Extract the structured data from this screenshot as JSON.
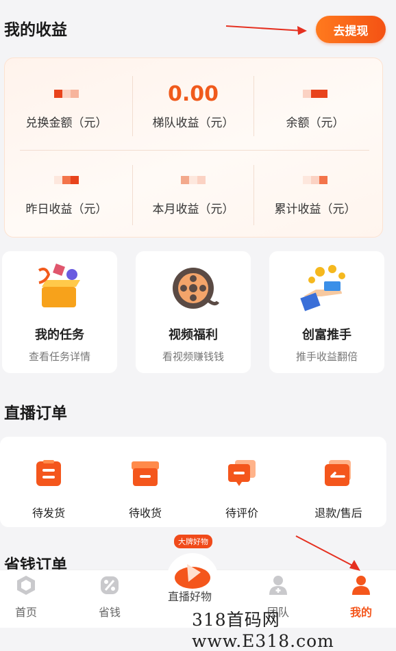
{
  "earnings": {
    "title": "我的收益",
    "withdraw_label": "去提现",
    "stats": [
      {
        "label": "兑换金额（元）",
        "value": ""
      },
      {
        "label": "梯队收益（元）",
        "value": "0.00"
      },
      {
        "label": "余额（元）",
        "value": ""
      },
      {
        "label": "昨日收益（元）",
        "value": ""
      },
      {
        "label": "本月收益（元）",
        "value": ""
      },
      {
        "label": "累计收益（元）",
        "value": ""
      }
    ]
  },
  "features": [
    {
      "title": "我的任务",
      "subtitle": "查看任务详情",
      "icon": "task-box-icon"
    },
    {
      "title": "视频福利",
      "subtitle": "看视频赚钱钱",
      "icon": "film-reel-icon"
    },
    {
      "title": "创富推手",
      "subtitle": "推手收益翻倍",
      "icon": "money-hand-icon"
    }
  ],
  "live_orders": {
    "title": "直播订单",
    "items": [
      {
        "label": "待发货",
        "icon": "pending-ship-icon"
      },
      {
        "label": "待收货",
        "icon": "pending-receive-icon"
      },
      {
        "label": "待评价",
        "icon": "pending-review-icon"
      },
      {
        "label": "退款/售后",
        "icon": "refund-icon"
      }
    ]
  },
  "save_orders": {
    "title": "省钱订单"
  },
  "tabbar": {
    "badge": "大牌好物",
    "items": [
      {
        "label": "首页",
        "icon": "home-icon"
      },
      {
        "label": "省钱",
        "icon": "save-icon"
      },
      {
        "label": "直播好物",
        "icon": "live-icon"
      },
      {
        "label": "团队",
        "icon": "team-icon"
      },
      {
        "label": "我的",
        "icon": "profile-icon",
        "active": true
      }
    ]
  },
  "watermark": "318首码网 www.E318.com",
  "colors": {
    "accent": "#f05a1c",
    "accent_light": "#ff7a1e",
    "background": "#f4f4f6"
  }
}
